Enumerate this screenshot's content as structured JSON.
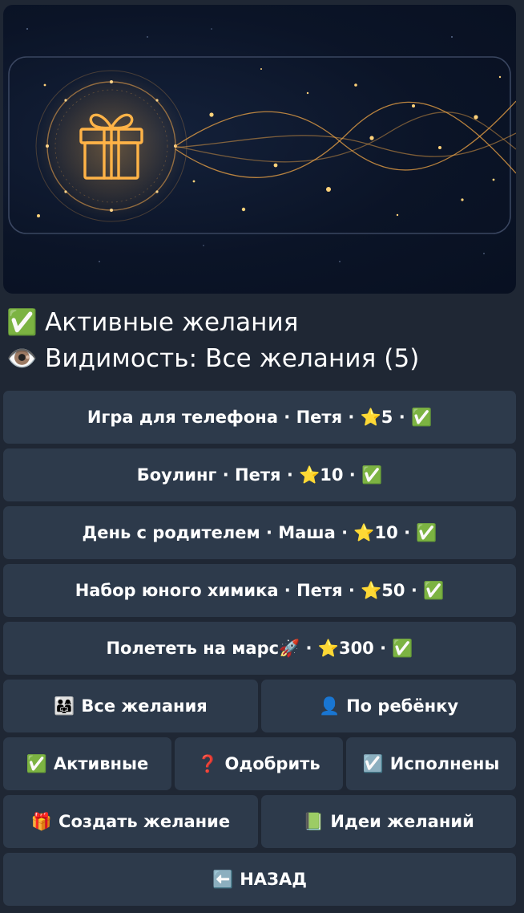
{
  "message": {
    "line1": {
      "icon": "✅",
      "text": "Активные желания"
    },
    "line2": {
      "icon": "👁️",
      "text": "Видимость: Все желания (5)"
    }
  },
  "wishes": [
    {
      "label": "Игра для телефона · Петя · ⭐5 · ✅"
    },
    {
      "label": "Боулинг · Петя · ⭐10 · ✅"
    },
    {
      "label": "День с родителем · Маша · ⭐10 · ✅"
    },
    {
      "label": "Набор юного химика · Петя · ⭐50 · ✅"
    },
    {
      "label": "Полететь на марс🚀 · ⭐300 · ✅"
    }
  ],
  "filters": {
    "all": {
      "icon": "👨‍👩‍👧",
      "label": "Все желания"
    },
    "by_child": {
      "icon": "👤",
      "label": "По ребёнку"
    }
  },
  "status": {
    "active": {
      "icon": "✅",
      "label": "Активные"
    },
    "approve": {
      "icon": "❓",
      "label": "Одобрить"
    },
    "done": {
      "icon": "☑️",
      "label": "Исполнены"
    }
  },
  "actions": {
    "create": {
      "icon": "🎁",
      "label": "Создать желание"
    },
    "ideas": {
      "icon": "📗",
      "label": "Идеи желаний"
    }
  },
  "back": {
    "icon": "⬅️",
    "label": "НАЗАД"
  }
}
